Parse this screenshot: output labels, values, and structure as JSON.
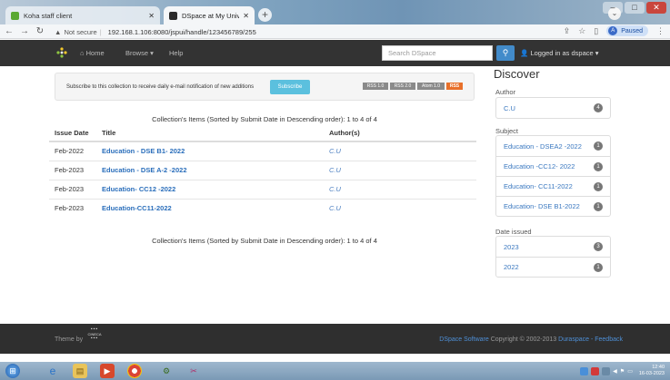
{
  "browser": {
    "tabs": [
      {
        "title": "Koha staff client",
        "favicon_color": "#5aa832",
        "active": false
      },
      {
        "title": "DSpace at My University: QUEST",
        "favicon_color": "#2a2a2a",
        "active": true
      }
    ],
    "new_tab": "+",
    "address": {
      "security": "Not secure",
      "url": "192.168.1.106:8080/jspui/handle/123456789/255"
    },
    "profile": {
      "initial": "A",
      "status": "Paused"
    }
  },
  "navbar": {
    "home": "Home",
    "browse": "Browse",
    "help": "Help",
    "search_placeholder": "Search DSpace",
    "logged_in": "Logged in as dspace"
  },
  "subscribe": {
    "text": "Subscribe to this collection to receive daily e-mail notification of new additions",
    "button": "Subscribe",
    "feeds": [
      "RSS 1.0",
      "RSS 2.0",
      "Atom 1.0",
      "RSS"
    ]
  },
  "collection": {
    "sort_info": "Collection's Items (Sorted by Submit Date in Descending order): 1 to 4 of 4",
    "headers": {
      "date": "Issue Date",
      "title": "Title",
      "authors": "Author(s)"
    },
    "items": [
      {
        "date": "Feb-2022",
        "title": "Education - DSE B1- 2022",
        "author": "C.U"
      },
      {
        "date": "Feb-2023",
        "title": "Education - DSE A-2 -2022",
        "author": "C.U"
      },
      {
        "date": "Feb-2023",
        "title": "Education- CC12 -2022",
        "author": "C.U"
      },
      {
        "date": "Feb-2023",
        "title": "Education-CC11-2022",
        "author": "C.U"
      }
    ]
  },
  "discover": {
    "title": "Discover",
    "author": {
      "label": "Author",
      "items": [
        {
          "name": "C.U",
          "count": "4"
        }
      ]
    },
    "subject": {
      "label": "Subject",
      "items": [
        {
          "name": "Education - DSEA2 -2022",
          "count": "1"
        },
        {
          "name": "Education -CC12- 2022",
          "count": "1"
        },
        {
          "name": "Education- CC11-2022",
          "count": "1"
        },
        {
          "name": "Education- DSE B1-2022",
          "count": "1"
        }
      ]
    },
    "date": {
      "label": "Date issued",
      "items": [
        {
          "name": "2023",
          "count": "3"
        },
        {
          "name": "2022",
          "count": "1"
        }
      ]
    }
  },
  "footer": {
    "theme_by": "Theme by",
    "cineca": "CINECA",
    "dspace_link": "DSpace Software",
    "copyright": "Copyright © 2002-2013",
    "duraspace": "Duraspace",
    "sep": "-",
    "feedback": "Feedback"
  },
  "taskbar": {
    "time": "12:40",
    "date": "16-03-2023"
  }
}
